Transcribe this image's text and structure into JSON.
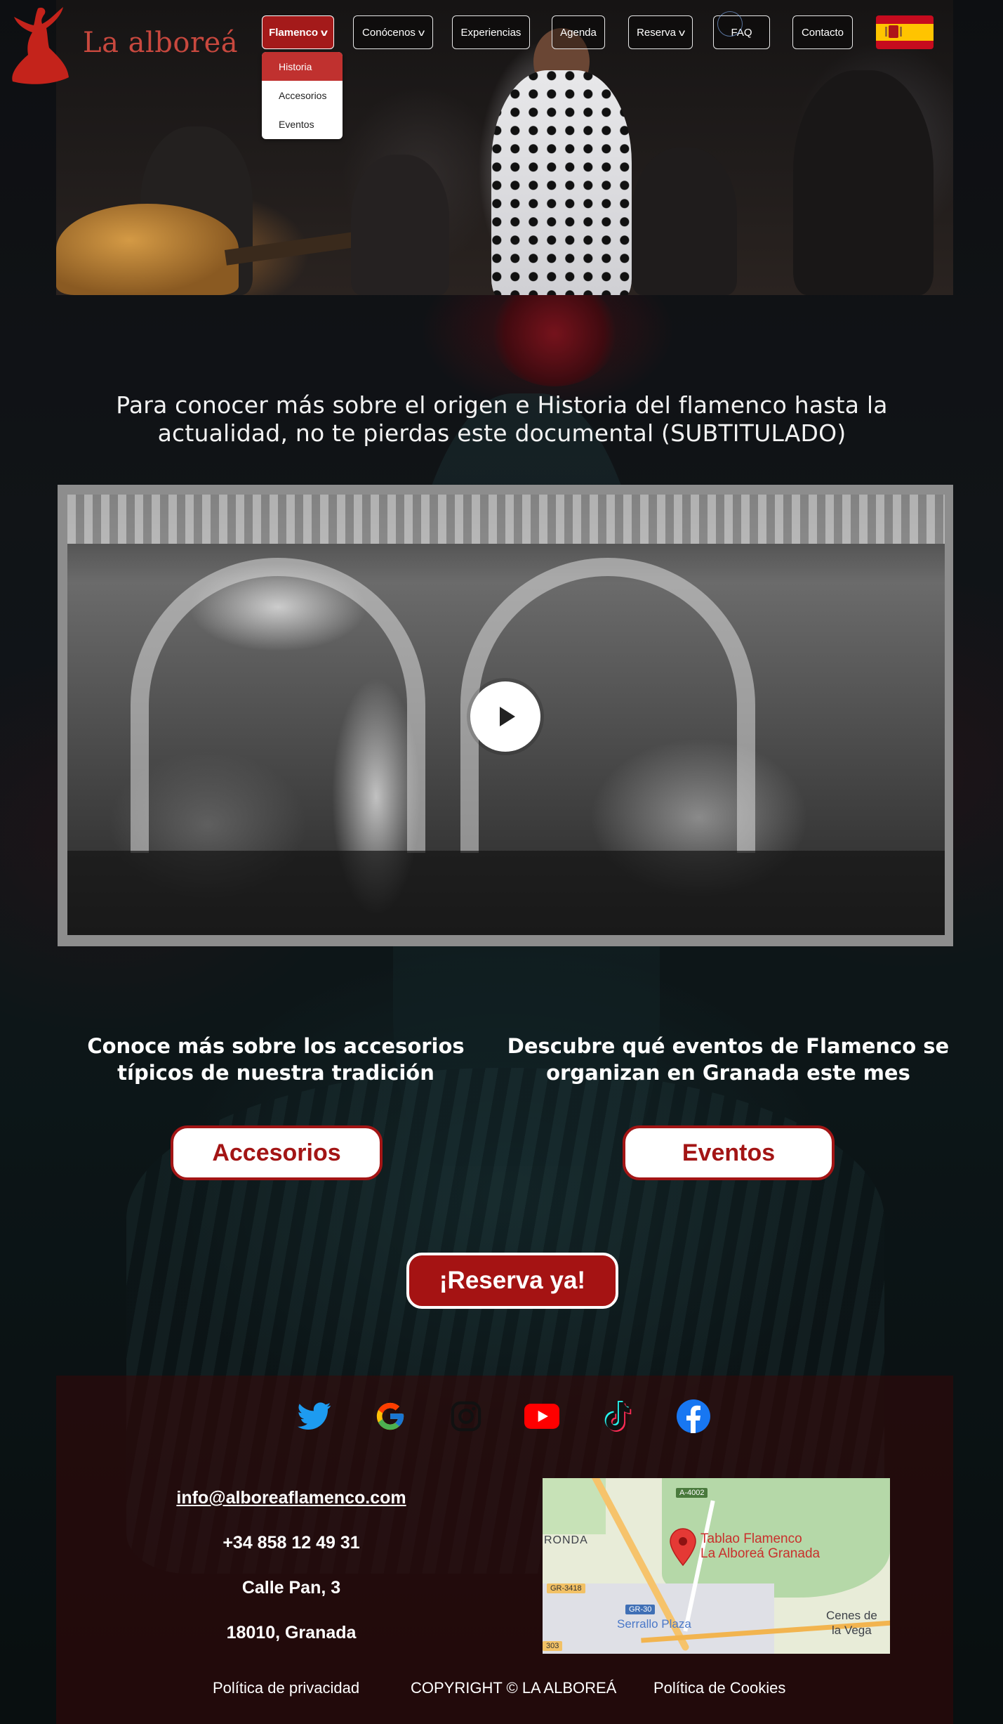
{
  "brand": {
    "name": "La alboreá"
  },
  "nav": {
    "items": [
      {
        "label": "Flamenco",
        "has_dropdown": true,
        "active": true
      },
      {
        "label": "Conócenos",
        "has_dropdown": true,
        "active": false
      },
      {
        "label": "Experiencias",
        "has_dropdown": false,
        "active": false
      },
      {
        "label": "Agenda",
        "has_dropdown": false,
        "active": false
      },
      {
        "label": "Reserva",
        "has_dropdown": true,
        "active": false
      },
      {
        "label": "FAQ",
        "has_dropdown": false,
        "active": false
      },
      {
        "label": "Contacto",
        "has_dropdown": false,
        "active": false
      }
    ],
    "dropdown": [
      {
        "label": "Historia",
        "active": true
      },
      {
        "label": "Accesorios",
        "active": false
      },
      {
        "label": "Eventos",
        "active": false
      }
    ],
    "language_flag": "spain-flag"
  },
  "intro": {
    "text": "Para conocer más sobre el origen e Historia del flamenco hasta la actualidad, no te pierdas este documental (SUBTITULADO)"
  },
  "video": {
    "play_icon": "play-icon"
  },
  "features": {
    "accesorios": {
      "title": "Conoce más sobre los accesorios típicos de nuestra tradición",
      "button": "Accesorios"
    },
    "eventos": {
      "title": "Descubre qué eventos de Flamenco se organizan en Granada este mes",
      "button": "Eventos"
    }
  },
  "cta": {
    "label": "¡Reserva ya!"
  },
  "social": [
    "twitter-icon",
    "google-icon",
    "instagram-icon",
    "youtube-icon",
    "tiktok-icon",
    "facebook-icon"
  ],
  "contact": {
    "email": "info@alboreaflamenco.com",
    "phone": "+34 858 12 49 31",
    "street": "Calle Pan, 3",
    "city": "18010, Granada"
  },
  "map": {
    "place_line1": "Tablao Flamenco",
    "place_line2": "La Alboreá Granada",
    "labels": {
      "road_a4002": "A-4002",
      "ronda": "RONDA",
      "gr3418": "GR-3418",
      "gr30": "GR-30",
      "serrallo": "Serrallo Plaza",
      "cenes1": "Cenes de",
      "cenes2": "la Vega",
      "r303": "303"
    }
  },
  "legal": {
    "privacy": "Política de privacidad",
    "copyright": "COPYRIGHT © LA ALBOREÁ",
    "cookies": "Política de Cookies"
  },
  "colors": {
    "brand_red": "#a31515",
    "logo_red": "#c8483e",
    "dropdown_active": "#c0312f"
  }
}
